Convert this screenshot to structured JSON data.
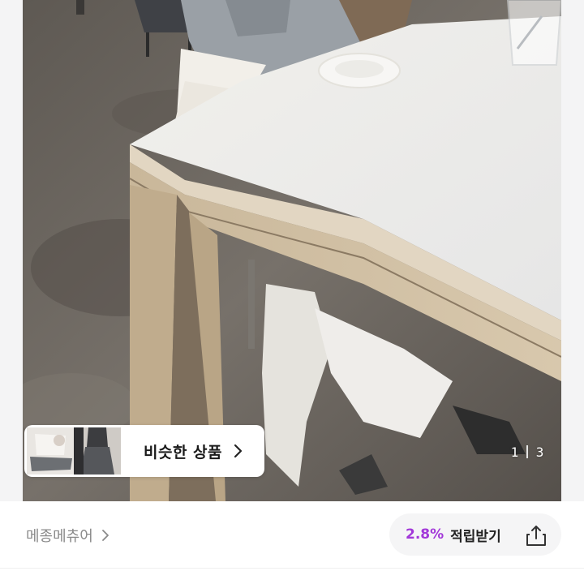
{
  "product_images": {
    "current_index": "1",
    "total": "3"
  },
  "similar_products": {
    "label": "비슷한 상품",
    "chevron_icon": "chevron-right-icon"
  },
  "store": {
    "name": "메종메츄어",
    "chevron_icon": "chevron-right-icon"
  },
  "reward": {
    "rate": "2.8%",
    "label": "적립받기",
    "share_icon": "share-icon"
  },
  "colors": {
    "accent": "#a238d9",
    "card_bg": "#ffffff",
    "pill_bg": "#f5f5f6",
    "muted_text": "#8a8a8a"
  }
}
